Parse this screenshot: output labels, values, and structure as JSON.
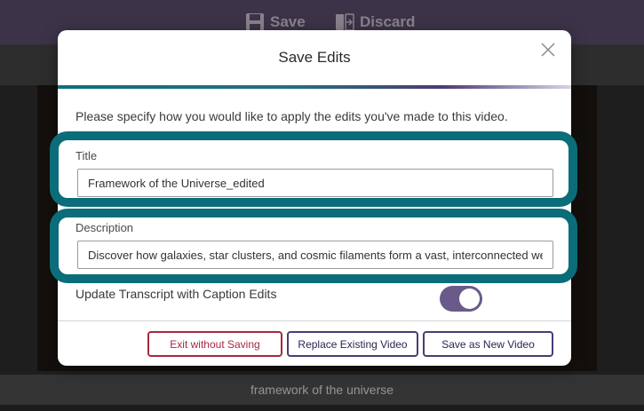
{
  "toolbar": {
    "save_label": "Save",
    "discard_label": "Discard"
  },
  "caption": {
    "text": "framework of the universe"
  },
  "modal": {
    "title": "Save Edits",
    "instructions": "Please specify how you would like to apply the edits you've made to this video.",
    "title_field": {
      "label": "Title",
      "value": "Framework of the Universe_edited"
    },
    "description_field": {
      "label": "Description",
      "value": "Discover how galaxies, star clusters, and cosmic filaments form a vast, interconnected web"
    },
    "toggle": {
      "label": "Update Transcript with Caption Edits",
      "on": true
    },
    "buttons": {
      "exit": "Exit without Saving",
      "replace": "Replace Existing Video",
      "save_new": "Save as New Video"
    }
  },
  "colors": {
    "accent_teal": "#0b6d79",
    "accent_purple": "#4b3c73",
    "danger": "#a8283f",
    "toolbar_bg": "#5c4f6f"
  }
}
